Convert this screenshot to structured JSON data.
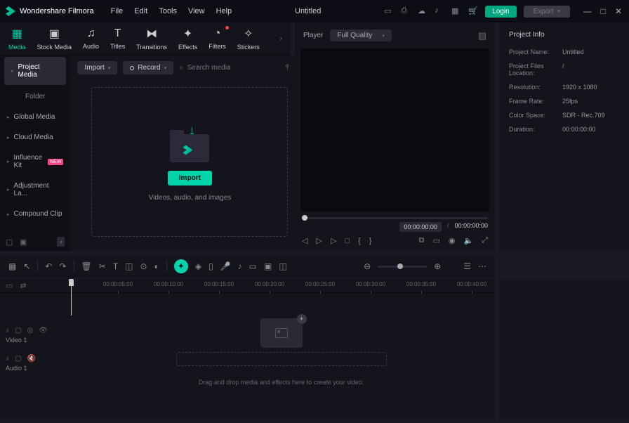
{
  "titlebar": {
    "app_name": "Wondershare Filmora",
    "menu": [
      "File",
      "Edit",
      "Tools",
      "View",
      "Help"
    ],
    "doc_title": "Untitled",
    "login": "Login",
    "export": "Export"
  },
  "tabs": [
    {
      "label": "Media",
      "icon": "media",
      "active": true
    },
    {
      "label": "Stock Media",
      "icon": "stock"
    },
    {
      "label": "Audio",
      "icon": "audio"
    },
    {
      "label": "Titles",
      "icon": "titles"
    },
    {
      "label": "Transitions",
      "icon": "trans"
    },
    {
      "label": "Effects",
      "icon": "fx"
    },
    {
      "label": "Filters",
      "icon": "filters",
      "dot": true
    },
    {
      "label": "Stickers",
      "icon": "stickers"
    }
  ],
  "sidebar": {
    "items": [
      {
        "label": "Project Media",
        "active": true
      },
      {
        "label": "Folder",
        "folder": true
      },
      {
        "label": "Global Media"
      },
      {
        "label": "Cloud Media"
      },
      {
        "label": "Influence Kit",
        "badge": "NEW"
      },
      {
        "label": "Adjustment La..."
      },
      {
        "label": "Compound Clip"
      }
    ]
  },
  "media_toolbar": {
    "import": "Import",
    "record": "Record",
    "search_placeholder": "Search media"
  },
  "dropzone": {
    "button": "Import",
    "hint": "Videos, audio, and images"
  },
  "player": {
    "label": "Player",
    "quality": "Full Quality",
    "current": "00:00:00:00",
    "total": "00:00:00:00"
  },
  "project_info": {
    "title": "Project Info",
    "rows": [
      {
        "k": "Project Name:",
        "v": "Untitled"
      },
      {
        "k": "Project Files Location:",
        "v": "/"
      },
      {
        "k": "Resolution:",
        "v": "1920 x 1080"
      },
      {
        "k": "Frame Rate:",
        "v": "25fps"
      },
      {
        "k": "Color Space:",
        "v": "SDR - Rec.709"
      },
      {
        "k": "Duration:",
        "v": "00:00:00:00"
      }
    ]
  },
  "timeline": {
    "ruler": [
      "00:00:05:00",
      "00:00:10:00",
      "00:00:15:00",
      "00:00:20:00",
      "00:00:25:00",
      "00:00:30:00",
      "00:00:35:00",
      "00:00:40:00"
    ],
    "tracks": [
      {
        "name": "Video 1",
        "type": "video"
      },
      {
        "name": "Audio 1",
        "type": "audio"
      }
    ],
    "hint": "Drag and drop media and effects here to create your video."
  }
}
